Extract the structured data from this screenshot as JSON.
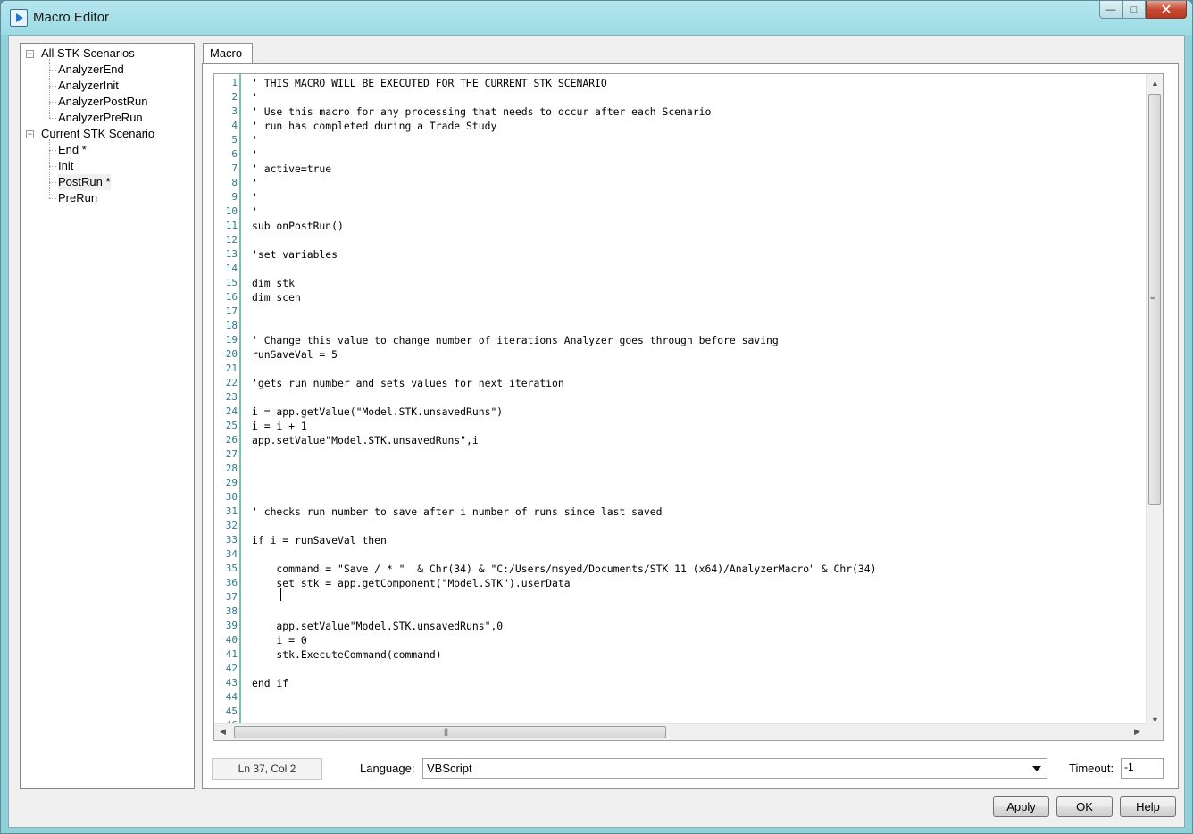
{
  "window": {
    "title": "Macro Editor",
    "minimize": "—",
    "maximize": "□",
    "close": "✕"
  },
  "tree": {
    "groups": [
      {
        "label": "All STK Scenarios",
        "expander": "−",
        "children": [
          "AnalyzerEnd",
          "AnalyzerInit",
          "AnalyzerPostRun",
          "AnalyzerPreRun"
        ]
      },
      {
        "label": "Current STK Scenario",
        "expander": "−",
        "children": [
          "End *",
          "Init",
          "PostRun *",
          "PreRun"
        ]
      }
    ]
  },
  "tab": {
    "label": "Macro"
  },
  "editor": {
    "lines": [
      "' THIS MACRO WILL BE EXECUTED FOR THE CURRENT STK SCENARIO",
      "'",
      "' Use this macro for any processing that needs to occur after each Scenario",
      "' run has completed during a Trade Study",
      "'",
      "'",
      "' active=true",
      "'",
      "'",
      "'",
      "sub onPostRun()",
      "",
      "'set variables",
      "",
      "dim stk",
      "dim scen",
      "",
      "",
      "' Change this value to change number of iterations Analyzer goes through before saving",
      "runSaveVal = 5",
      "",
      "'gets run number and sets values for next iteration",
      "",
      "i = app.getValue(\"Model.STK.unsavedRuns\")",
      "i = i + 1",
      "app.setValue\"Model.STK.unsavedRuns\",i",
      "",
      "",
      "",
      "",
      "' checks run number to save after i number of runs since last saved",
      "",
      "if i = runSaveVal then",
      "",
      "    command = \"Save / * \"  & Chr(34) & \"C:/Users/msyed/Documents/STK 11 (x64)/AnalyzerMacro\" & Chr(34)",
      "    set stk = app.getComponent(\"Model.STK\").userData",
      "    ",
      "",
      "    app.setValue\"Model.STK.unsavedRuns\",0",
      "    i = 0",
      "    stk.ExecuteCommand(command)",
      "",
      "end if",
      "",
      "",
      ""
    ]
  },
  "status": {
    "position": "Ln 37, Col 2",
    "language_label": "Language:",
    "language_value": "VBScript",
    "timeout_label": "Timeout:",
    "timeout_value": "-1"
  },
  "buttons": {
    "apply": "Apply",
    "ok": "OK",
    "help": "Help"
  }
}
